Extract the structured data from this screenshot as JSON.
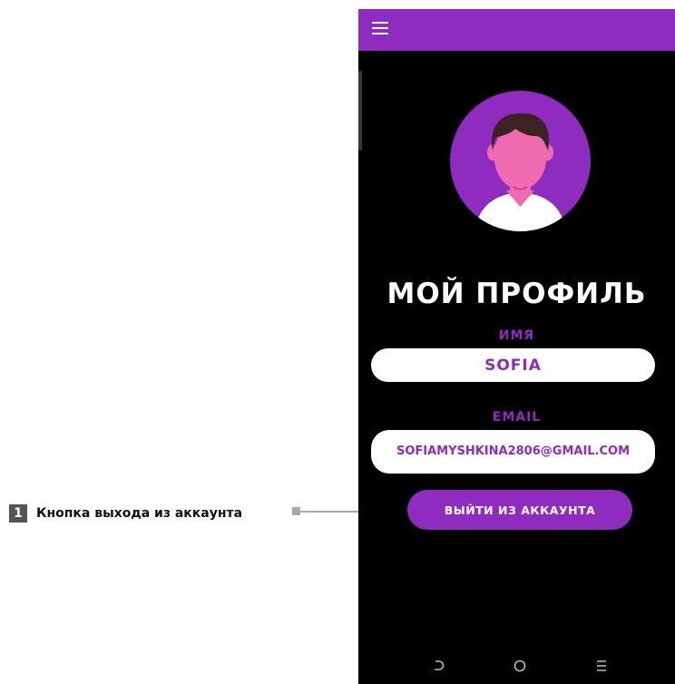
{
  "annotation": {
    "number": "1",
    "text": "Кнопка выхода из аккаунта"
  },
  "profile": {
    "title": "МОЙ ПРОФИЛЬ",
    "name_label": "ИМЯ",
    "name_value": "SOFIA",
    "email_label": "EMAIL",
    "email_value": "SOFIAMYSHKINA2806@GMAIL.COM",
    "logout_label": "ВЫЙТИ ИЗ АККАУНТА"
  },
  "icons": {
    "menu": "menu-icon",
    "avatar": "avatar-icon",
    "back": "nav-back-icon",
    "home": "nav-home-icon",
    "recent": "nav-recent-icon"
  },
  "colors": {
    "accent": "#8f2bbf",
    "background": "#000000",
    "field": "#ffffff",
    "avatar_face": "#f06ab0"
  }
}
